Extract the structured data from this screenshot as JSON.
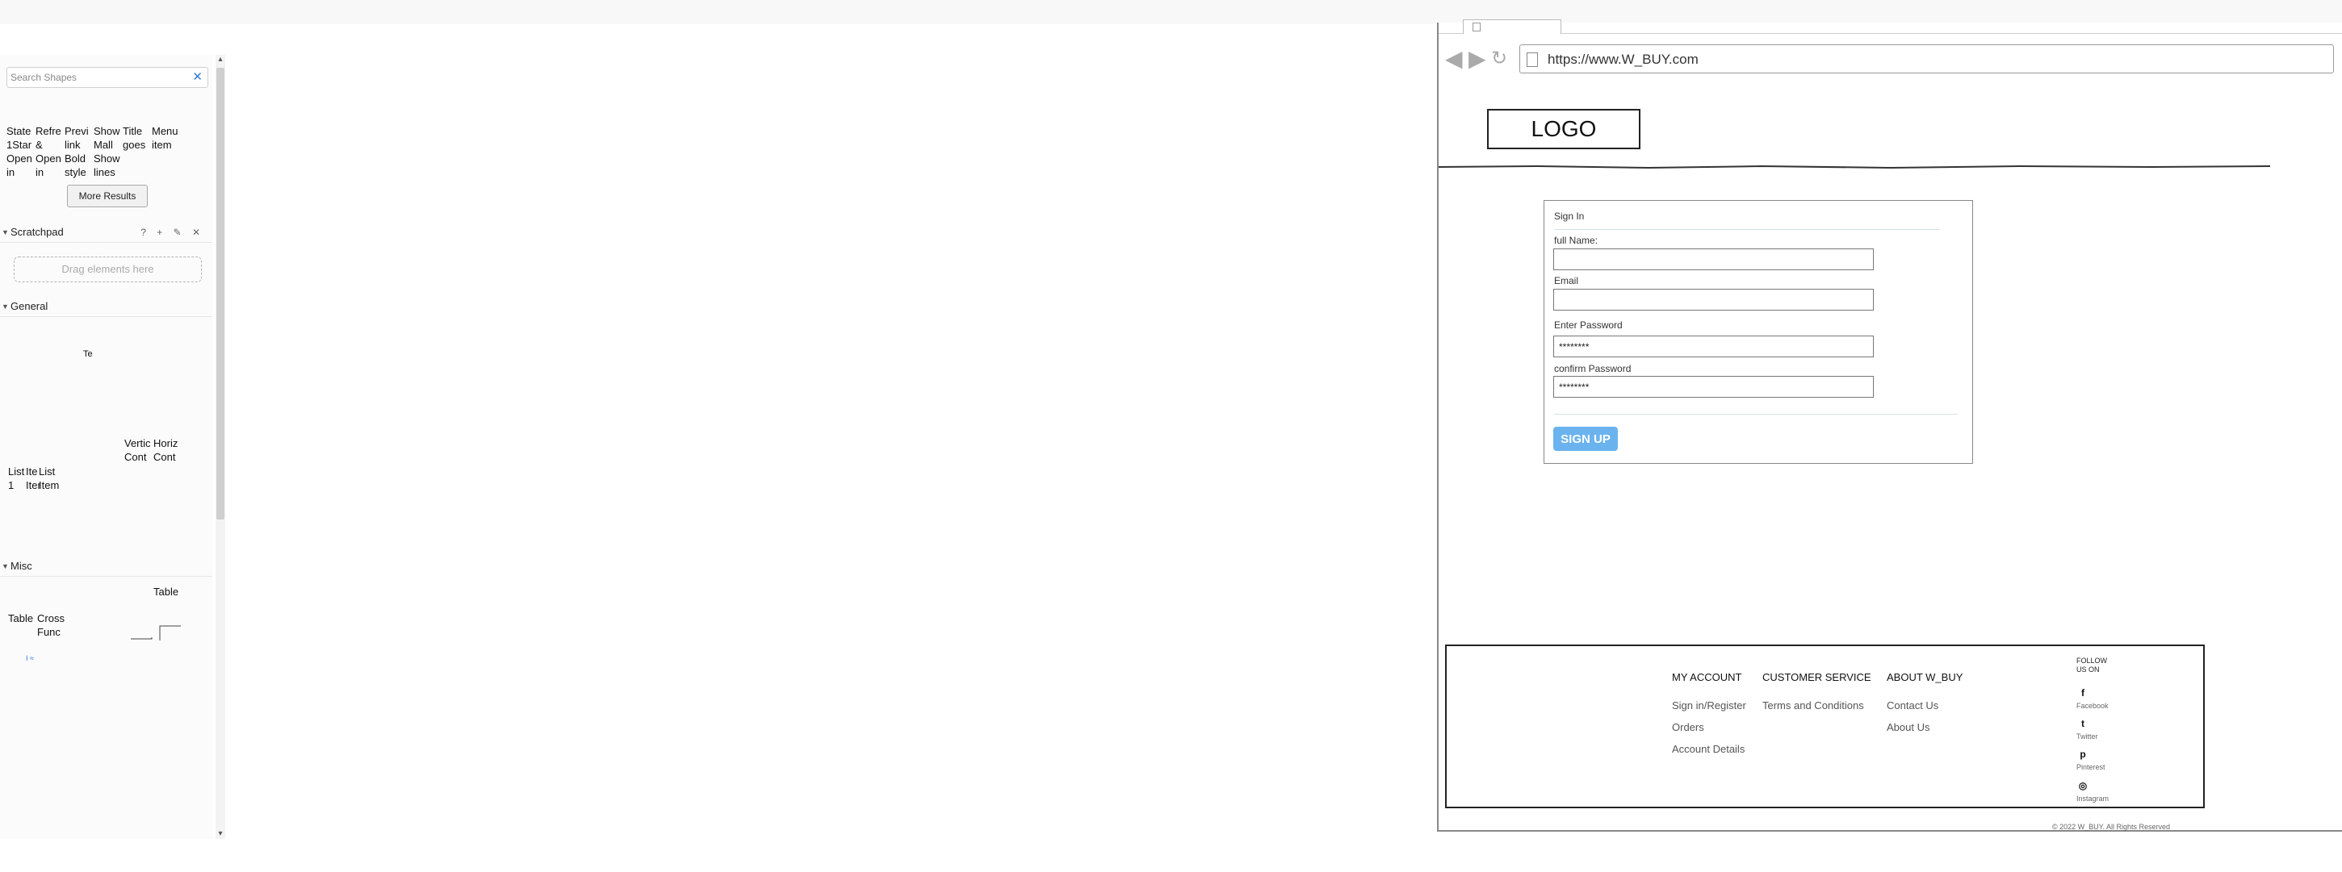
{
  "sidebar": {
    "search_placeholder": "Search Shapes",
    "results": [
      "State\n1Star\nOpen\nin",
      "Refre\n&\nOpen\nin",
      "Previ\nlink\nBold\nstyle",
      "Show\nMall\nShow\nlines",
      "Title\ngoes",
      "Menu\nitem"
    ],
    "more_results": "More Results",
    "sections": {
      "scratchpad": "Scratchpad",
      "general": "General",
      "misc": "Misc"
    },
    "scratchpad_tools": "? + ✎ ✕",
    "drag_hint": "Drag elements here",
    "general_shapes": [
      "Te",
      "Vertic\nCont",
      "Horiz\nCont",
      "List\n1",
      "Ite\nItem",
      "List\nItem"
    ],
    "misc_shapes": [
      "Table",
      "Table",
      "Cross\nFunc"
    ]
  },
  "browser": {
    "url": "https://www.W_BUY.com",
    "logo": "LOGO"
  },
  "form": {
    "title": "Sign In",
    "fields": [
      {
        "label": "full Name:",
        "value": ""
      },
      {
        "label": "Email",
        "value": ""
      },
      {
        "label": "Enter Password",
        "value": "********"
      },
      {
        "label": "confirm Password",
        "value": "********"
      }
    ],
    "submit": "SIGN UP"
  },
  "footer": {
    "columns": [
      {
        "title": "MY ACCOUNT",
        "links": [
          "Sign in/Register",
          "Orders",
          "Account Details"
        ]
      },
      {
        "title": "CUSTOMER SERVICE",
        "links": [
          "Terms and Conditions"
        ]
      },
      {
        "title": "ABOUT W_BUY",
        "links": [
          "Contact Us",
          "About Us"
        ]
      }
    ],
    "follow": "FOLLOW US ON",
    "social": [
      {
        "name": "Facebook",
        "icon": "facebook-icon",
        "glyph": "f"
      },
      {
        "name": "Twitter",
        "icon": "twitter-icon",
        "glyph": "t"
      },
      {
        "name": "Pinterest",
        "icon": "pinterest-icon",
        "glyph": "p"
      },
      {
        "name": "Instagram",
        "icon": "instagram-icon",
        "glyph": "◎"
      }
    ],
    "copyright": "© 2022 W_BUY. All Rights Reserved"
  },
  "colors": {
    "accent_button": "#6bb3ee",
    "search_clear": "#3478d6"
  }
}
